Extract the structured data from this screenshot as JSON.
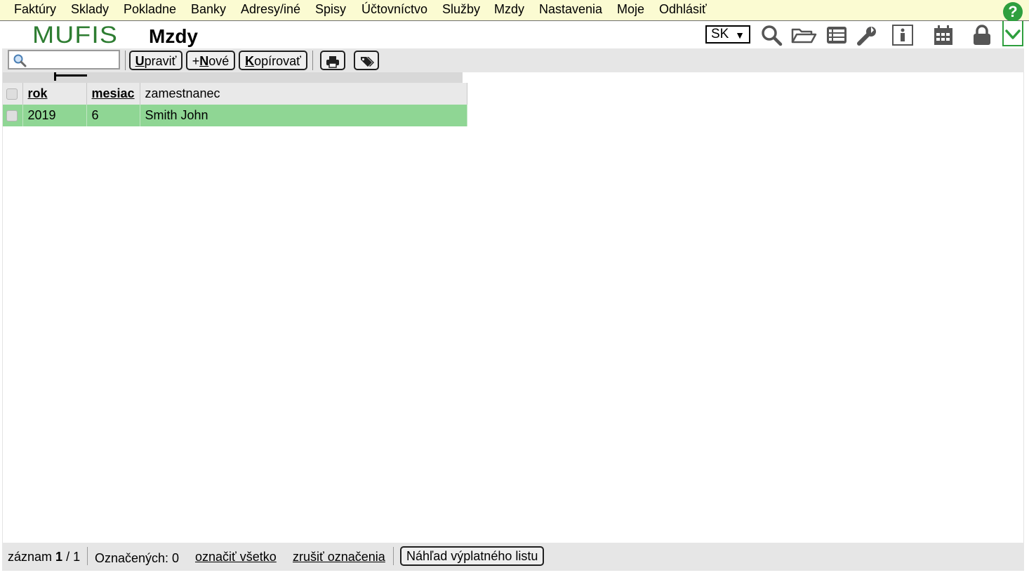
{
  "menu": {
    "items": [
      "Faktúry",
      "Sklady",
      "Pokladne",
      "Banky",
      "Adresy/iné",
      "Spisy",
      "Účtovníctvo",
      "Služby",
      "Mzdy",
      "Nastavenia",
      "Moje",
      "Odhlásiť"
    ],
    "help_label": "?"
  },
  "header": {
    "logo_text": "MUFIS",
    "title": "Mzdy",
    "language": "SK"
  },
  "icons": {
    "search": "search-icon",
    "folder": "folder-open-icon",
    "list": "list-icon",
    "settings": "wrench-icon",
    "info": "info-icon",
    "calendar": "calendar-icon",
    "lock": "lock-icon",
    "collapse": "chevron-down-icon"
  },
  "toolbar": {
    "search_value": "",
    "edit_key": "U",
    "edit_rest": "praviť",
    "new_prefix": "+",
    "new_key": "N",
    "new_rest": "ové",
    "copy_key": "K",
    "copy_rest": "opírovať"
  },
  "table": {
    "columns": [
      "rok",
      "mesiac",
      "zamestnanec"
    ],
    "rows": [
      {
        "rok": "2019",
        "mesiac": "6",
        "zamestnanec": "Smith John"
      }
    ]
  },
  "footer": {
    "record_label": "záznam",
    "record_current": "1",
    "record_total": "/ 1",
    "marked": "Označených: 0",
    "mark_all": "označiť všetko",
    "unmark": "zrušiť označenia",
    "preview_button": "Náhľad výplatného listu"
  },
  "colors": {
    "menu_bg": "#fbfbd2",
    "selected_row": "#8fd694",
    "brand_green": "#2e7d32",
    "help_green": "#2e9f3e"
  }
}
